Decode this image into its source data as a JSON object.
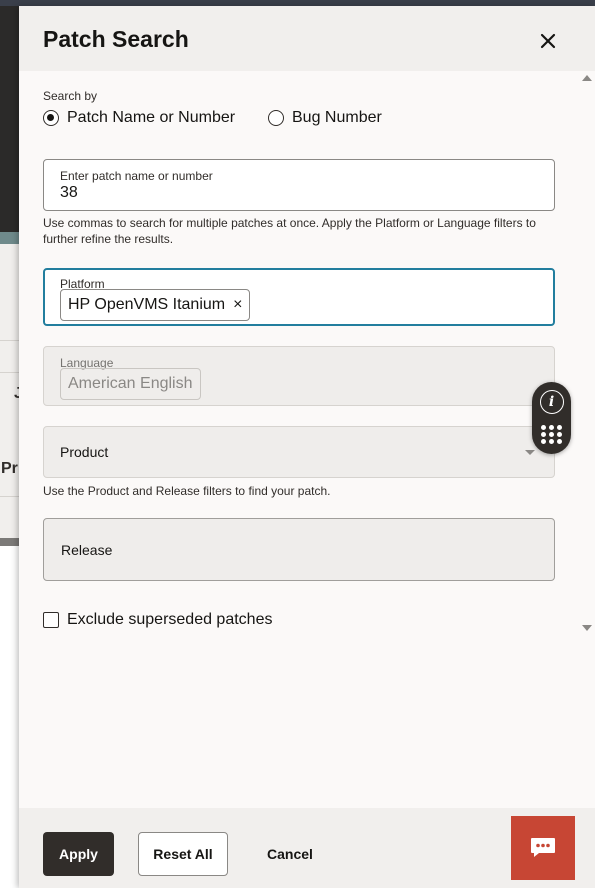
{
  "background": {
    "text_top": "J",
    "text_mid": "Pr"
  },
  "drawer": {
    "title": "Patch Search",
    "close_icon": "close-icon"
  },
  "search_by": {
    "label": "Search by",
    "options": [
      {
        "label": "Patch Name or Number",
        "checked": true
      },
      {
        "label": "Bug Number",
        "checked": false
      }
    ]
  },
  "patch_field": {
    "label": "Enter patch name or number",
    "value": "38",
    "help": "Use commas to search for multiple patches at once. Apply the Platform or Language filters to further refine the results."
  },
  "platform_field": {
    "label": "Platform",
    "chips": [
      "HP OpenVMS Itanium"
    ],
    "remove_glyph": "×"
  },
  "language_field": {
    "label": "Language",
    "chips": [
      "American English"
    ]
  },
  "product_field": {
    "label": "Product",
    "help": "Use the Product and Release filters to find your patch."
  },
  "release_field": {
    "label": "Release"
  },
  "exclude_superseded": {
    "label": "Exclude superseded patches",
    "checked": false
  },
  "footer": {
    "apply_label": "Apply",
    "reset_label": "Reset All",
    "cancel_label": "Cancel",
    "chat_icon": "chat-icon"
  },
  "floating_widget": {
    "info_icon": "info-icon",
    "info_glyph": "i",
    "apps_icon": "apps-grid-icon"
  },
  "colors": {
    "accent_focus": "#227e9e",
    "primary_button": "#312d2a",
    "chat_button": "#c74634"
  }
}
